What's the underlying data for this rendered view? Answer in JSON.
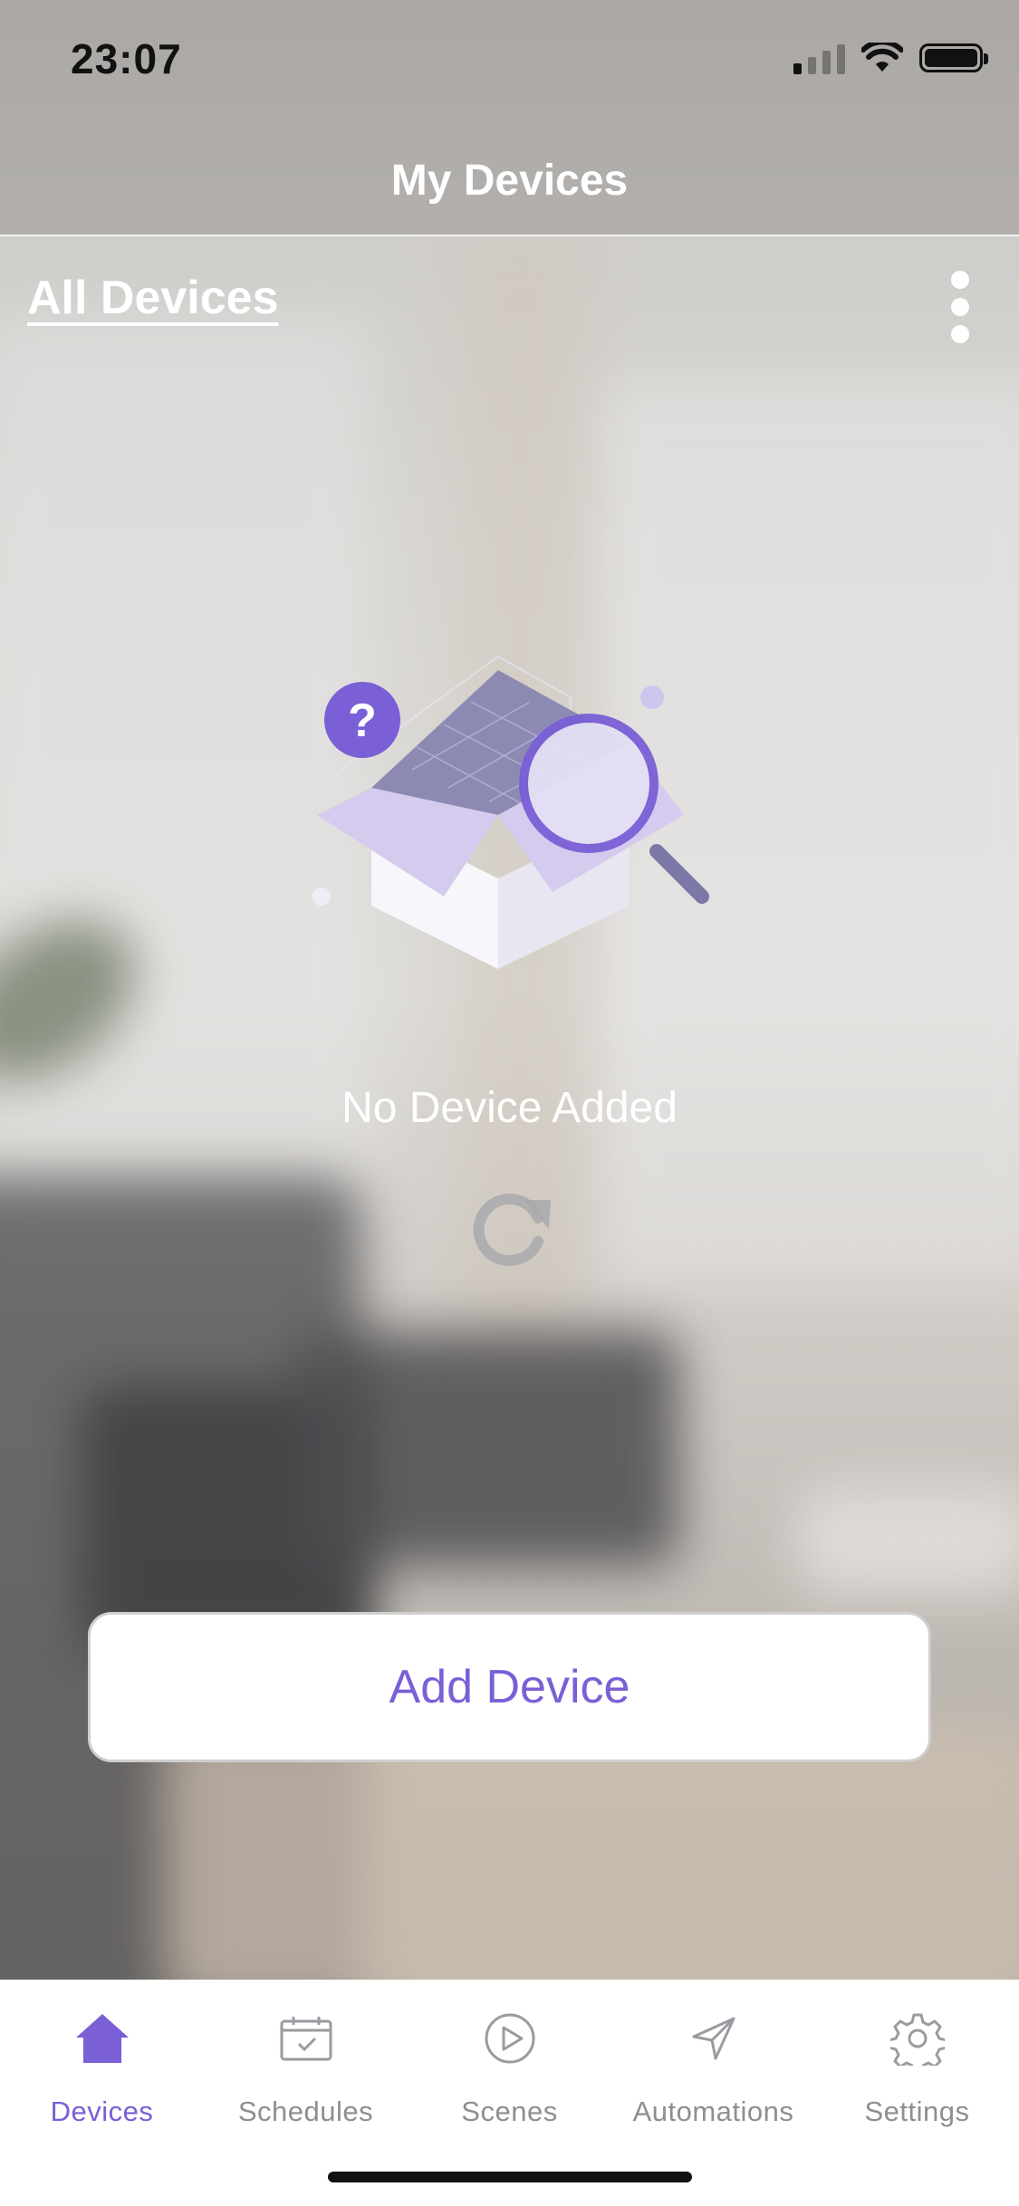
{
  "status_bar": {
    "time": "23:07"
  },
  "header": {
    "title": "My Devices"
  },
  "section": {
    "filter_label": "All Devices"
  },
  "empty_state": {
    "message": "No Device Added",
    "illustration_glyph": "?"
  },
  "actions": {
    "add_device_label": "Add Device"
  },
  "tabs": [
    {
      "label": "Devices",
      "icon": "house-icon",
      "active": true
    },
    {
      "label": "Schedules",
      "icon": "calendar-check-icon",
      "active": false
    },
    {
      "label": "Scenes",
      "icon": "play-circle-icon",
      "active": false
    },
    {
      "label": "Automations",
      "icon": "paper-plane-icon",
      "active": false
    },
    {
      "label": "Settings",
      "icon": "gear-icon",
      "active": false
    }
  ],
  "colors": {
    "accent": "#7a5fd6",
    "tab_inactive": "#8e8e93",
    "header_text": "#ffffff"
  }
}
